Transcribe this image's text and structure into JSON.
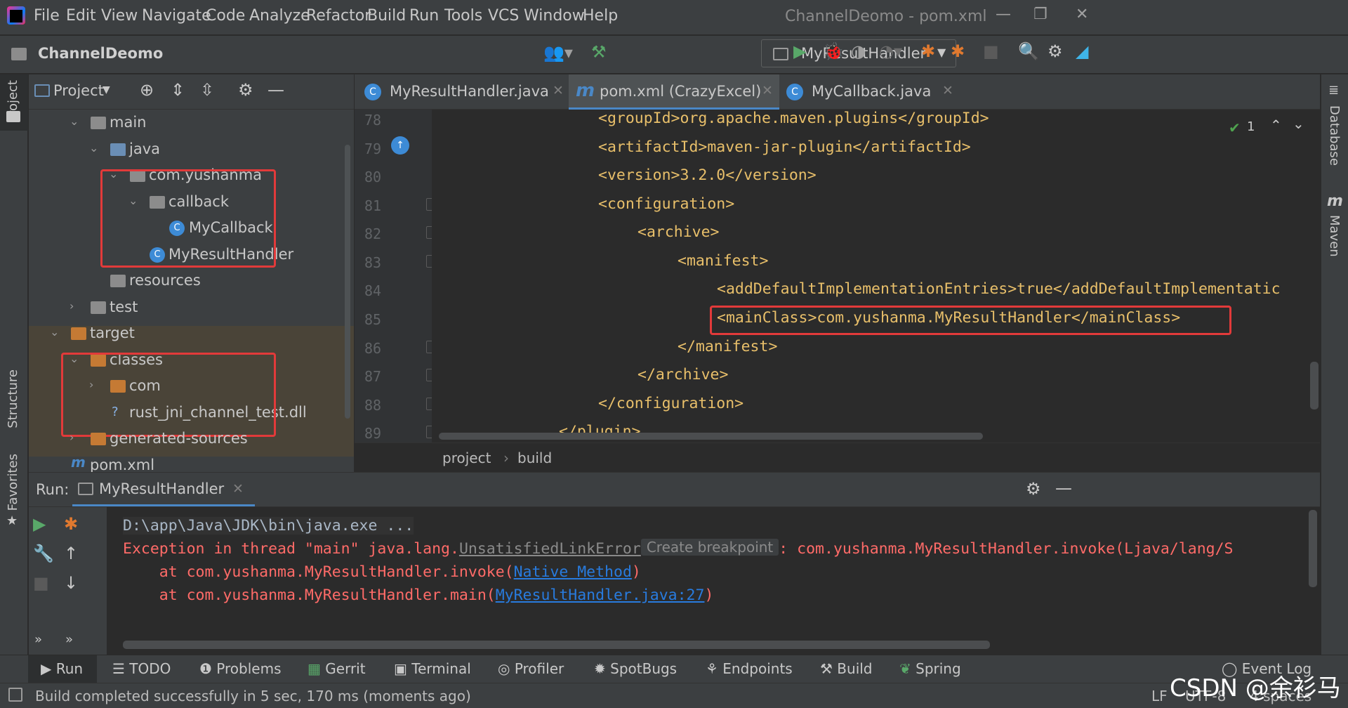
{
  "menu": {
    "items": [
      "File",
      "Edit",
      "View",
      "Navigate",
      "Code",
      "Analyze",
      "Refactor",
      "Build",
      "Run",
      "Tools",
      "VCS",
      "Window",
      "Help"
    ],
    "window_title": "ChannelDeomo - pom.xml"
  },
  "toolbar": {
    "project_name": "ChannelDeomo",
    "run_config": "MyResultHandler"
  },
  "left_stripe": {
    "project": "Project",
    "structure": "Structure",
    "favorites": "Favorites"
  },
  "right_stripe": {
    "database": "Database",
    "maven": "Maven"
  },
  "project_panel": {
    "title": "Project",
    "tree": [
      {
        "label": "main"
      },
      {
        "label": "java"
      },
      {
        "label": "com.yushanma"
      },
      {
        "label": "callback"
      },
      {
        "label": "MyCallback"
      },
      {
        "label": "MyResultHandler"
      },
      {
        "label": "resources"
      },
      {
        "label": "test"
      },
      {
        "label": "target"
      },
      {
        "label": "classes"
      },
      {
        "label": "com"
      },
      {
        "label": "rust_jni_channel_test.dll"
      },
      {
        "label": "generated-sources"
      },
      {
        "label": "pom.xml"
      }
    ]
  },
  "editor": {
    "tabs": [
      {
        "label": "MyResultHandler.java",
        "icon": "C"
      },
      {
        "label": "pom.xml (CrazyExcel)",
        "icon": "m"
      },
      {
        "label": "MyCallback.java",
        "icon": "C"
      }
    ],
    "line_numbers": [
      "78",
      "79",
      "80",
      "81",
      "82",
      "83",
      "84",
      "85",
      "86",
      "87",
      "88",
      "89"
    ],
    "lines": [
      "<groupId>org.apache.maven.plugins</groupId>",
      "<artifactId>maven-jar-plugin</artifactId>",
      "<version>3.2.0</version>",
      "<configuration>",
      "<archive>",
      "<manifest>",
      "<addDefaultImplementationEntries>true</addDefaultImplementatic",
      "<mainClass>com.yushanma.MyResultHandler</mainClass>",
      "</manifest>",
      "</archive>",
      "</configuration>",
      "</plugin>"
    ],
    "inspection_count": "1",
    "breadcrumb": [
      "project",
      "build"
    ]
  },
  "run_panel": {
    "label": "Run:",
    "tab": "MyResultHandler",
    "console": {
      "line1": "D:\\app\\Java\\JDK\\bin\\java.exe ...",
      "exc_prefix": "Exception in thread \"main\" java.lang.",
      "exc_class": "UnsatisfiedLinkError",
      "tooltip": "Create breakpoint",
      "exc_suffix": ": com.yushanma.MyResultHandler.invoke(Ljava/lang/S",
      "at1_prefix": "    at com.yushanma.MyResultHandler.invoke(",
      "at1_link": "Native Method",
      "at1_suffix": ")",
      "at2_prefix": "    at com.yushanma.MyResultHandler.main(",
      "at2_link": "MyResultHandler.java:27",
      "at2_suffix": ")"
    }
  },
  "bottom_tabs": [
    "Run",
    "TODO",
    "Problems",
    "Gerrit",
    "Terminal",
    "Profiler",
    "SpotBugs",
    "Endpoints",
    "Build",
    "Spring",
    "Event Log"
  ],
  "status": {
    "message": "Build completed successfully in 5 sec, 170 ms (moments ago)",
    "line_sep": "LF",
    "encoding": "UTF-8",
    "indent": "4 spaces"
  },
  "watermark": "CSDN @余衫马",
  "colors": {
    "highlight_box": "#e23a3a",
    "xml_tag": "#e8bf6a",
    "error_text": "#ff6b68",
    "link": "#287bde"
  }
}
